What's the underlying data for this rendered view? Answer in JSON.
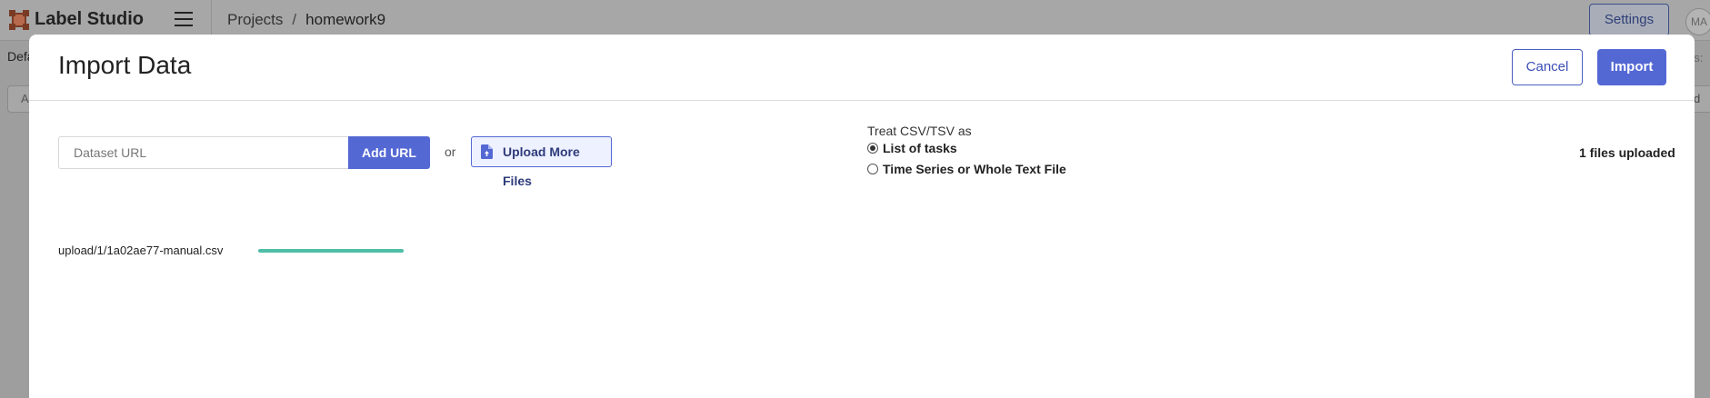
{
  "app": {
    "name": "Label Studio",
    "logo_icon": "label-studio-logo-icon"
  },
  "topbar": {
    "breadcrumb": [
      "Projects",
      "homework9"
    ],
    "separator": "/",
    "settings_label": "Settings",
    "avatar_initials": "MA"
  },
  "background": {
    "left_text": "Defa",
    "left_box_text": "A",
    "right_text": "ns:",
    "right_box_text": "d"
  },
  "modal": {
    "title": "Import Data",
    "cancel_label": "Cancel",
    "import_label": "Import",
    "url_placeholder": "Dataset URL",
    "add_url_label": "Add URL",
    "or_text": "or",
    "upload_label": "Upload More Files",
    "treat_label": "Treat CSV/TSV as",
    "treat_options": [
      {
        "label": "List of tasks",
        "checked": true
      },
      {
        "label": "Time Series or Whole Text File",
        "checked": false
      }
    ],
    "files_uploaded": "1 files uploaded",
    "files": [
      {
        "name": "upload/1/1a02ae77-manual.csv",
        "progress": 1.0
      }
    ]
  },
  "colors": {
    "accent": "#5468d4",
    "progress": "#4fbfa6",
    "logo": "#b86a4f"
  }
}
